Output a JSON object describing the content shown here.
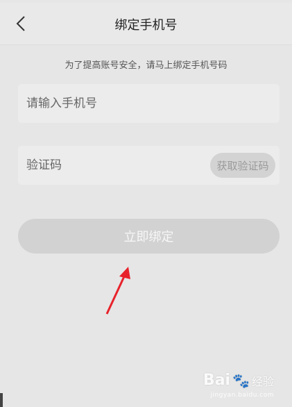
{
  "header": {
    "title": "绑定手机号",
    "back_icon": "chevron-left-icon"
  },
  "hint": "为了提高账号安全，请马上绑定手机号码",
  "phone_field": {
    "placeholder": "请输入手机号",
    "value": ""
  },
  "code_field": {
    "placeholder": "验证码",
    "value": "",
    "get_code_label": "获取验证码"
  },
  "submit_label": "立即绑定",
  "annotation": {
    "arrow_color": "#e8222b"
  },
  "watermark": {
    "brand": "Bai",
    "brand_suffix": "经验",
    "url": "jingyan.baidu.com"
  },
  "colors": {
    "background": "#e6e6e6",
    "button_disabled": "#d2d2d2"
  }
}
